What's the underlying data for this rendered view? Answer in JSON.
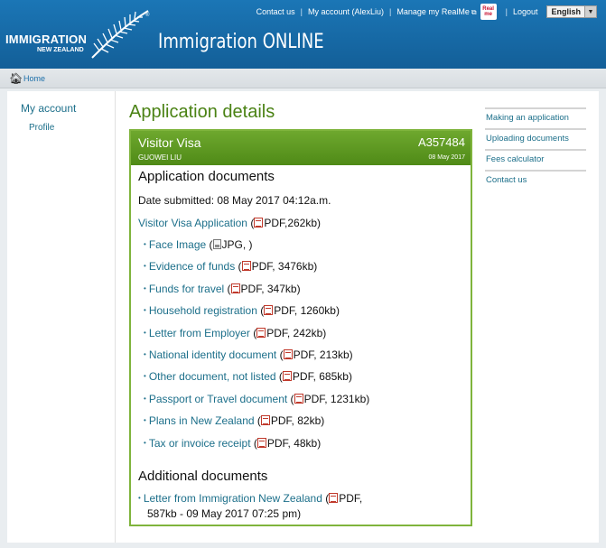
{
  "topnav": {
    "contact": "Contact us",
    "account": "My account (AlexLiu)",
    "realme_link": "Manage my RealMe",
    "realme_badge_1": "Real",
    "realme_badge_2": "me",
    "logout": "Logout",
    "language": "English"
  },
  "logo": {
    "line1": "IMMIGRATION",
    "line2": "NEW ZEALAND",
    "mark": "®"
  },
  "site_title": "Immigration ONLINE",
  "breadcrumb": {
    "home": "Home"
  },
  "leftnav": {
    "title": "My account",
    "item": "Profile"
  },
  "main": {
    "title": "Application details",
    "application": {
      "visa": "Visitor Visa",
      "reference": "A357484",
      "applicant": "GUOWEI LIU",
      "date": "08 May 2017"
    },
    "documents_title": "Application documents",
    "submitted": "Date submitted: 08 May 2017  04:12a.m.",
    "main_doc": {
      "name": "Visitor Visa Application",
      "format": "PDF,262kb"
    },
    "documents": [
      {
        "name": "Face Image",
        "icon": "jpg",
        "format": "JPG, "
      },
      {
        "name": "Evidence of funds",
        "icon": "pdf",
        "format": "PDF, 3476kb"
      },
      {
        "name": "Funds for travel",
        "icon": "pdf",
        "format": "PDF, 347kb"
      },
      {
        "name": "Household registration",
        "icon": "pdf",
        "format": "PDF, 1260kb"
      },
      {
        "name": "Letter from Employer",
        "icon": "pdf",
        "format": "PDF, 242kb"
      },
      {
        "name": "National identity document",
        "icon": "pdf",
        "format": "PDF, 213kb"
      },
      {
        "name": "Other document, not listed",
        "icon": "pdf",
        "format": "PDF, 685kb"
      },
      {
        "name": "Passport or Travel document",
        "icon": "pdf",
        "format": "PDF, 1231kb"
      },
      {
        "name": "Plans in New Zealand",
        "icon": "pdf",
        "format": "PDF, 82kb"
      },
      {
        "name": "Tax or invoice receipt",
        "icon": "pdf",
        "format": "PDF, 48kb"
      }
    ],
    "additional_title": "Additional documents",
    "additional_doc": {
      "name": "Letter from Immigration New Zealand",
      "format_line1": "PDF,",
      "format_line2": "587kb - 09 May 2017 07:25 pm)"
    }
  },
  "rightnav": {
    "items": [
      "Making an application",
      "Uploading documents",
      "Fees calculator",
      "Contact us"
    ]
  },
  "colors": {
    "header_blue": "#1b76b6",
    "green_accent": "#4f8a17",
    "link": "#1c6f8a"
  }
}
